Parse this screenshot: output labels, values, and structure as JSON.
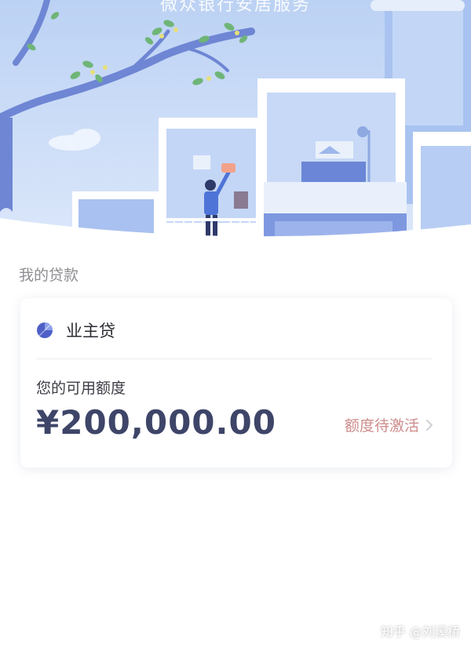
{
  "hero": {
    "caption": "微众银行安居服务"
  },
  "loans": {
    "section_title": "我的贷款",
    "card": {
      "product_name": "业主贷",
      "credit_label": "您的可用额度",
      "credit_amount": "¥200,000.00",
      "activate_label": "额度待激活"
    }
  },
  "watermark": "知乎 @刘溪桥",
  "colors": {
    "amount_text": "#3e4568",
    "activate_text": "#cf8c8c",
    "product_dot": "#4e5fc8",
    "hero_sky": "#c9dcf7"
  },
  "icons": {
    "product": "product-dot-icon",
    "activate": "chevron-right-icon"
  }
}
